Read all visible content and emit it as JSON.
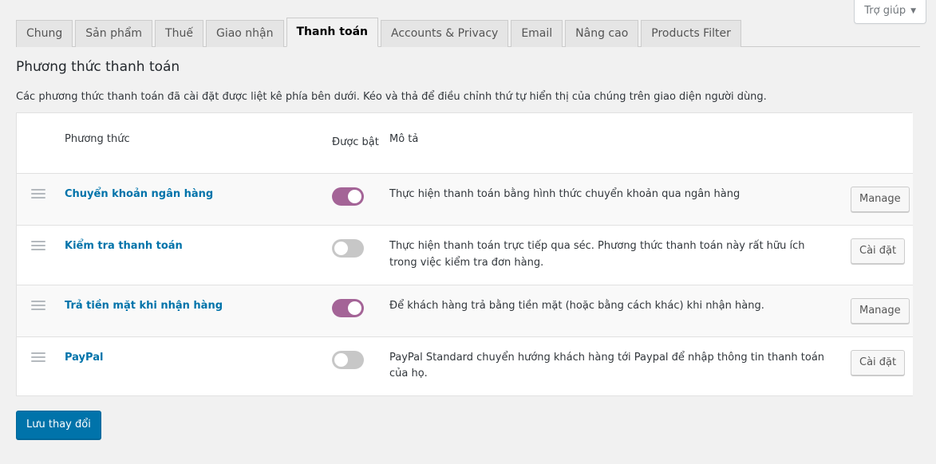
{
  "header": {
    "help_label": "Trợ giúp",
    "help_caret": "▼"
  },
  "tabs": [
    {
      "label": "Chung",
      "active": false
    },
    {
      "label": "Sản phẩm",
      "active": false
    },
    {
      "label": "Thuế",
      "active": false
    },
    {
      "label": "Giao nhận",
      "active": false
    },
    {
      "label": "Thanh toán",
      "active": true
    },
    {
      "label": "Accounts & Privacy",
      "active": false
    },
    {
      "label": "Email",
      "active": false
    },
    {
      "label": "Nâng cao",
      "active": false
    },
    {
      "label": "Products Filter",
      "active": false
    }
  ],
  "section": {
    "title": "Phương thức thanh toán",
    "description": "Các phương thức thanh toán đã cài đặt được liệt kê phía bên dưới. Kéo và thả để điều chỉnh thứ tự hiển thị của chúng trên giao diện người dùng."
  },
  "table": {
    "columns": {
      "sort": "",
      "method": "Phương thức",
      "enabled": "Được bật",
      "description": "Mô tả",
      "action": ""
    },
    "rows": [
      {
        "name": "Chuyển khoản ngân hàng",
        "enabled": true,
        "description": "Thực hiện thanh toán bằng hình thức chuyển khoản qua ngân hàng",
        "action": "Manage"
      },
      {
        "name": "Kiểm tra thanh toán",
        "enabled": false,
        "description": "Thực hiện thanh toán trực tiếp qua séc. Phương thức thanh toán này rất hữu ích trong việc kiểm tra đơn hàng.",
        "action": "Cài đặt"
      },
      {
        "name": "Trả tiền mặt khi nhận hàng",
        "enabled": true,
        "description": "Để khách hàng trả bằng tiền mặt (hoặc bằng cách khác) khi nhận hàng.",
        "action": "Manage"
      },
      {
        "name": "PayPal",
        "enabled": false,
        "description": "PayPal Standard chuyển hướng khách hàng tới Paypal để nhập thông tin thanh toán của họ.",
        "action": "Cài đặt"
      }
    ]
  },
  "footer": {
    "save_label": "Lưu thay đổi"
  },
  "colors": {
    "accent_blue": "#0073aa",
    "toggle_on": "#a46497",
    "toggle_off": "#c7c7c7",
    "page_bg": "#f1f1f1"
  }
}
